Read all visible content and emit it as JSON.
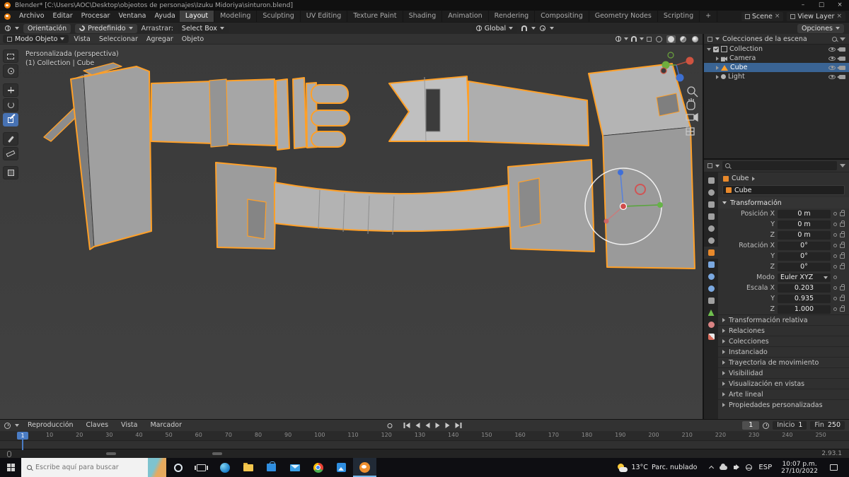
{
  "window": {
    "title": "Blender* [C:\\Users\\AOC\\Desktop\\objeotos de personajes\\Izuku Midoriya\\sinturon.blend]",
    "minimize": "–",
    "maximize": "□",
    "close": "×"
  },
  "menubar": {
    "menus": [
      "Archivo",
      "Editar",
      "Procesar",
      "Ventana",
      "Ayuda"
    ],
    "workspaces": [
      {
        "label": "Layout",
        "active": true
      },
      {
        "label": "Modeling"
      },
      {
        "label": "Sculpting"
      },
      {
        "label": "UV Editing"
      },
      {
        "label": "Texture Paint"
      },
      {
        "label": "Shading"
      },
      {
        "label": "Animation"
      },
      {
        "label": "Rendering"
      },
      {
        "label": "Compositing"
      },
      {
        "label": "Geometry Nodes"
      },
      {
        "label": "Scripting"
      },
      {
        "label": "+"
      }
    ],
    "scene": {
      "label": "Scene",
      "unlink": "×"
    },
    "view_layer": {
      "label": "View Layer",
      "unlink": "×"
    }
  },
  "toolbar": {
    "orientation": "Orientación",
    "preset": "Predefinido",
    "drag_label": "Arrastrar:",
    "drag_value": "Select Box",
    "transform_orientation": "Global",
    "options": "Opciones"
  },
  "viewport": {
    "mode": "Modo Objeto",
    "menus": [
      "Vista",
      "Seleccionar",
      "Agregar",
      "Objeto"
    ],
    "overlay_line1": "Personalizada (perspectiva)",
    "overlay_line2": "(1) Collection | Cube",
    "tools": [
      {
        "name": "select-box",
        "cls": "t-select"
      },
      {
        "name": "cursor",
        "cls": "t-cursor"
      },
      {
        "name": "move",
        "cls": "t-move",
        "gap": true
      },
      {
        "name": "rotate",
        "cls": "t-rotate"
      },
      {
        "name": "scale",
        "cls": "t-scale",
        "active": true
      },
      {
        "name": "annotate",
        "cls": "t-annotate",
        "gap": true
      },
      {
        "name": "measure",
        "cls": "t-measure"
      },
      {
        "name": "add-cube",
        "cls": "t-cube",
        "gap": true
      }
    ]
  },
  "outliner": {
    "title": "Colecciones de la escena",
    "items": [
      {
        "label": "Collection",
        "indent": 0,
        "expanded": true,
        "checkbox": true,
        "cls": "icn-collection"
      },
      {
        "label": "Camera",
        "indent": 1,
        "cls": "icn-camera"
      },
      {
        "label": "Cube",
        "indent": 1,
        "selected": true,
        "cls": "icn-mesh"
      },
      {
        "label": "Light",
        "indent": 1,
        "cls": "icn-light"
      }
    ]
  },
  "properties": {
    "tabs": [
      {
        "name": "tool",
        "cls": "pt-tool"
      },
      {
        "name": "render",
        "cls": "pt-render"
      },
      {
        "name": "output",
        "cls": "pt-output"
      },
      {
        "name": "view-layer",
        "cls": "pt-vlayer"
      },
      {
        "name": "scene",
        "cls": "pt-scene"
      },
      {
        "name": "world",
        "cls": "pt-world"
      },
      {
        "name": "object",
        "cls": "pt-object",
        "active": true
      },
      {
        "name": "modifiers",
        "cls": "pt-mod"
      },
      {
        "name": "particles",
        "cls": "pt-part"
      },
      {
        "name": "physics",
        "cls": "pt-phys"
      },
      {
        "name": "constraints",
        "cls": "pt-constr"
      },
      {
        "name": "object-data",
        "cls": "pt-data"
      },
      {
        "name": "material",
        "cls": "pt-mat"
      },
      {
        "name": "texture",
        "cls": "pt-tex"
      }
    ],
    "breadcrumb": "Cube",
    "name": "Cube",
    "transform_title": "Transformación",
    "position": [
      {
        "label": "Posición X",
        "value": "0 m"
      },
      {
        "label": "Y",
        "value": "0 m"
      },
      {
        "label": "Z",
        "value": "0 m"
      }
    ],
    "rotation": [
      {
        "label": "Rotación X",
        "value": "0°"
      },
      {
        "label": "Y",
        "value": "0°"
      },
      {
        "label": "Z",
        "value": "0°"
      }
    ],
    "mode_label": "Modo",
    "mode_value": "Euler XYZ",
    "scale": [
      {
        "label": "Escala X",
        "value": "0.203"
      },
      {
        "label": "Y",
        "value": "0.935"
      },
      {
        "label": "Z",
        "value": "1.000"
      }
    ],
    "sections": [
      "Transformación relativa",
      "Relaciones",
      "Colecciones",
      "Instanciado",
      "Trayectoria de movimiento",
      "Visibilidad",
      "Visualización en vistas",
      "Arte lineal",
      "Propiedades personalizadas"
    ]
  },
  "timeline": {
    "menus": [
      "Reproducción",
      "Claves",
      "Vista",
      "Marcador"
    ],
    "current_frame": "1",
    "start_label": "Inicio",
    "start_value": "1",
    "end_label": "Fin",
    "end_value": "250",
    "ticks": [
      "1",
      "10",
      "20",
      "30",
      "40",
      "50",
      "60",
      "70",
      "80",
      "90",
      "100",
      "110",
      "120",
      "130",
      "140",
      "150",
      "160",
      "170",
      "180",
      "190",
      "200",
      "210",
      "220",
      "230",
      "240",
      "250"
    ]
  },
  "statusbar": {
    "version": "2.93.1"
  },
  "taskbar": {
    "search_placeholder": "Escribe aquí para buscar",
    "weather_temp": "13°C",
    "weather_desc": "Parc. nublado",
    "language": "ESP",
    "time": "10:07 p.m.",
    "date": "27/10/2022"
  }
}
